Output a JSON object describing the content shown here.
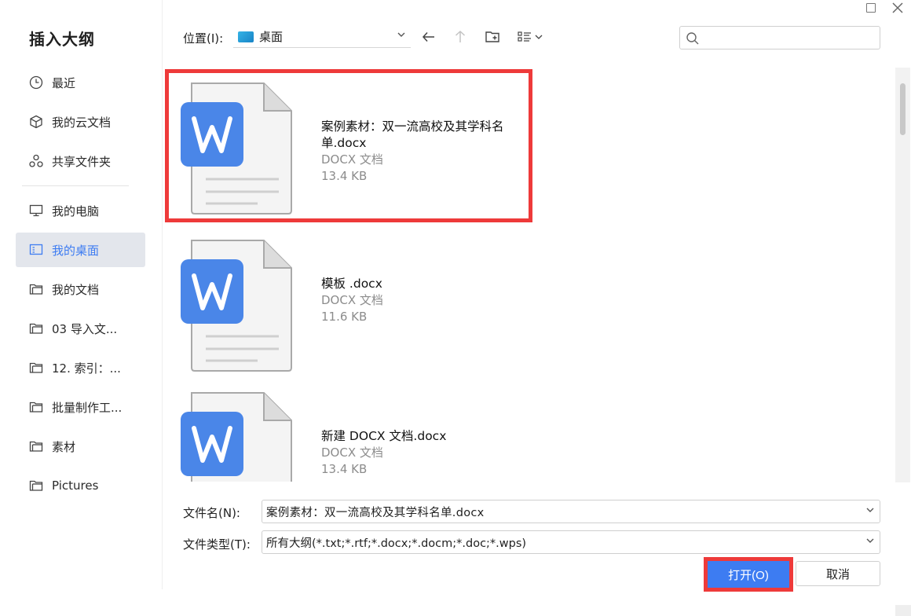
{
  "dialog": {
    "title": "插入大纲"
  },
  "sidebar": {
    "items": [
      {
        "id": "recent",
        "label": "最近",
        "icon": "clock-icon"
      },
      {
        "id": "cloud",
        "label": "我的云文档",
        "icon": "cloud-cube-icon"
      },
      {
        "id": "shared",
        "label": "共享文件夹",
        "icon": "share-icon"
      },
      {
        "id": "computer",
        "label": "我的电脑",
        "icon": "monitor-icon"
      },
      {
        "id": "desktop",
        "label": "我的桌面",
        "icon": "desktop-icon",
        "active": true
      },
      {
        "id": "documents",
        "label": "我的文档",
        "icon": "folder-icon"
      },
      {
        "id": "folder03",
        "label": "03 导入文...",
        "icon": "folder-icon"
      },
      {
        "id": "folder12",
        "label": "12. 索引：...",
        "icon": "folder-icon"
      },
      {
        "id": "batch",
        "label": "批量制作工...",
        "icon": "folder-icon"
      },
      {
        "id": "material",
        "label": "素材",
        "icon": "folder-icon"
      },
      {
        "id": "pictures",
        "label": "Pictures",
        "icon": "folder-icon"
      }
    ]
  },
  "toolbar": {
    "location_label": "位置(I):",
    "location_value": "桌面",
    "search_placeholder": ""
  },
  "files": [
    {
      "name": "案例素材：双一流高校及其学科名单.docx",
      "type": "DOCX 文档",
      "size": "13.4 KB",
      "selected": true
    },
    {
      "name": "模板 .docx",
      "type": "DOCX 文档",
      "size": "11.6 KB",
      "selected": false
    },
    {
      "name": "新建 DOCX 文档.docx",
      "type": "DOCX 文档",
      "size": "13.4 KB",
      "selected": false
    }
  ],
  "footer": {
    "filename_label": "文件名(N):",
    "filename_value": "案例素材：双一流高校及其学科名单.docx",
    "filetype_label": "文件类型(T):",
    "filetype_value": "所有大纲(*.txt;*.rtf;*.docx;*.docm;*.doc;*.wps)",
    "open_label": "打开(O)",
    "cancel_label": "取消"
  },
  "colors": {
    "accent": "#3d7cf2",
    "highlight": "#ee3a3a",
    "word_blue": "#4a86e8",
    "active_nav": "#e3e6ec"
  }
}
